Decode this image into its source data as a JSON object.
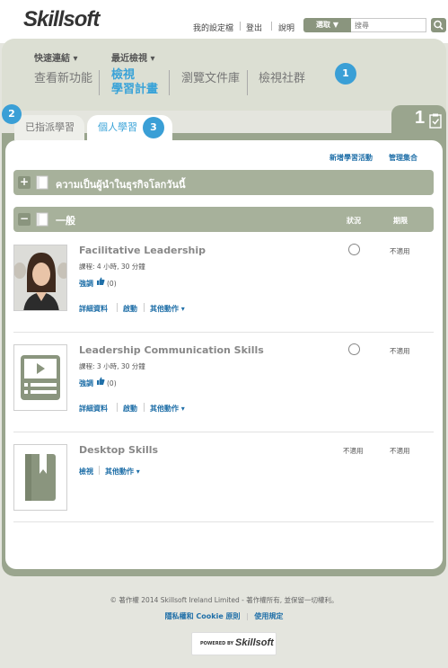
{
  "header": {
    "logo_text": "Skillsoft",
    "links": [
      "我的設定檔",
      "登出",
      "說明"
    ],
    "select_label": "選取 ▼",
    "search_placeholder": "搜尋"
  },
  "nav": {
    "quick_links_label": "快速連結 ▾",
    "recent_label": "最近檢視 ▾",
    "items": [
      "查看新功能",
      "檢視",
      "學習計畫",
      "瀏覽文件庫",
      "檢視社群"
    ]
  },
  "badges": {
    "b1": "1",
    "b2": "2",
    "b3": "3"
  },
  "tabs": {
    "assigned": "已指派學習",
    "personal": "個人學習"
  },
  "count": "1",
  "actions": {
    "new_activity": "新增學習活動",
    "manage_collections": "管理集合"
  },
  "groups": [
    {
      "title": "ความเป็นผู้นำในธุรกิจโลกวันนี้",
      "toggle": "+"
    },
    {
      "title": "一般",
      "toggle": "−",
      "col_status": "狀況",
      "col_due": "期限"
    }
  ],
  "courses": [
    {
      "title": "Facilitative Leadership",
      "duration": "課程: 4 小時, 30 分鐘",
      "recommend": "強調",
      "likes": "(0)",
      "links": [
        "詳細資料",
        "啟動",
        "其他動作 ▾"
      ],
      "due": "不適用"
    },
    {
      "title": "Leadership Communication Skills",
      "duration": "課程: 3 小時, 30 分鐘",
      "recommend": "強調",
      "likes": "(0)",
      "links": [
        "詳細資料",
        "啟動",
        "其他動作 ▾"
      ],
      "due": "不適用"
    },
    {
      "title": "Desktop Skills",
      "links": [
        "檢視",
        "其他動作 ▾"
      ],
      "status": "不適用",
      "due": "不適用"
    }
  ],
  "footer": {
    "copyright": "© 著作權 2014 Skillsoft Ireland Limited - 著作權所有, 並保留一切權利。",
    "privacy": "隱私權和 Cookie 原則",
    "terms": "使用規定",
    "powered_by": "POWERED BY",
    "powered_logo": "Skillsoft"
  },
  "colors": {
    "accent": "#3a9fd6",
    "panel": "#9aa58e",
    "link": "#1f6fa8"
  }
}
